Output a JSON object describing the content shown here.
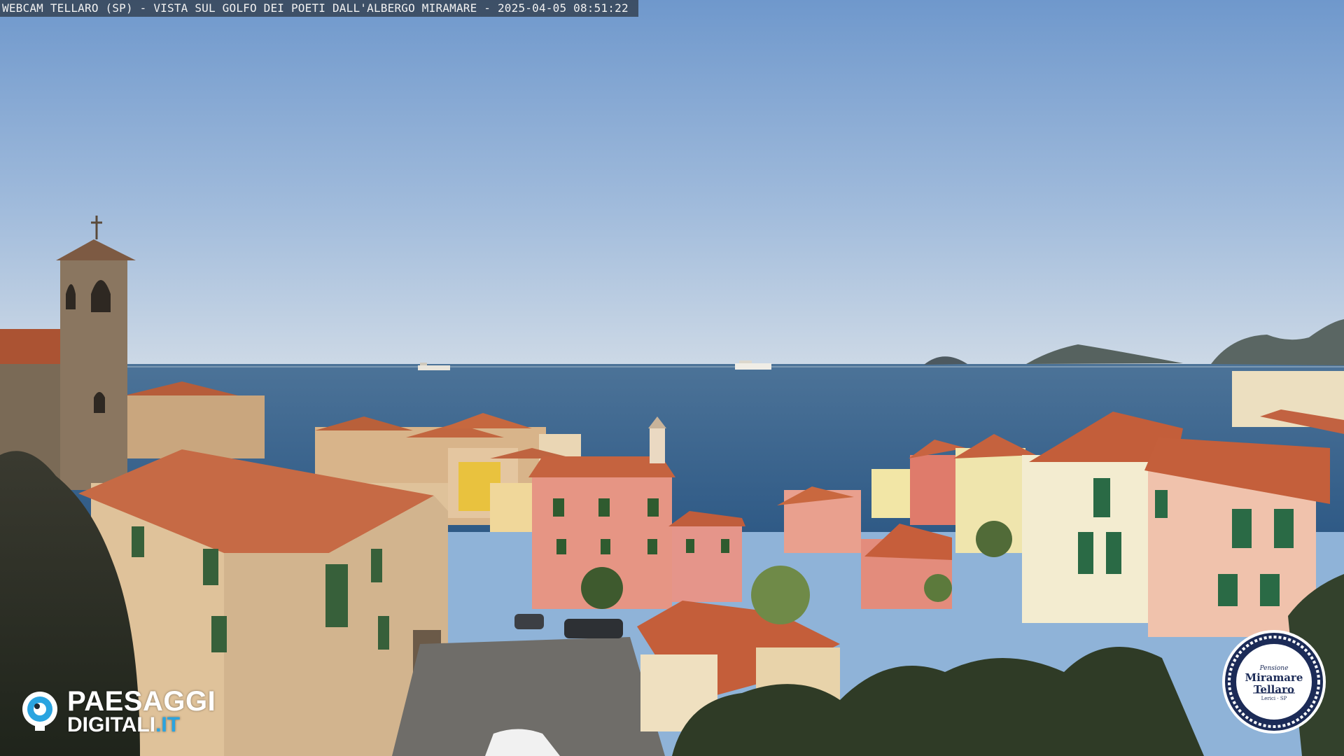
{
  "overlay": {
    "caption": "WEBCAM TELLARO (SP) - VISTA SUL GOLFO DEI POETI DALL'ALBERGO MIRAMARE - 2025-04-05 08:51:22"
  },
  "logo_left": {
    "icon": "eye-icon",
    "line1": "PAESAGGI",
    "line2_main": "DIGITALI",
    "line2_tld": ".IT",
    "accent_color": "#2aa4e0"
  },
  "badge": {
    "small_text": "Pensione",
    "name_line1": "Miramare",
    "name_line2": "Tellaro",
    "sub_text": "Lerici · SP",
    "color": "#1c2b57"
  },
  "scene": {
    "sky_color_top": "#6f98cc",
    "sky_color_horizon": "#c7d6e6",
    "sea_color": "#3f6b93",
    "roof_color": "#c8643e",
    "wall_colors": [
      "#e0c59c",
      "#e59a86",
      "#f0e6b6",
      "#e8b6a0",
      "#7a6a56"
    ]
  }
}
